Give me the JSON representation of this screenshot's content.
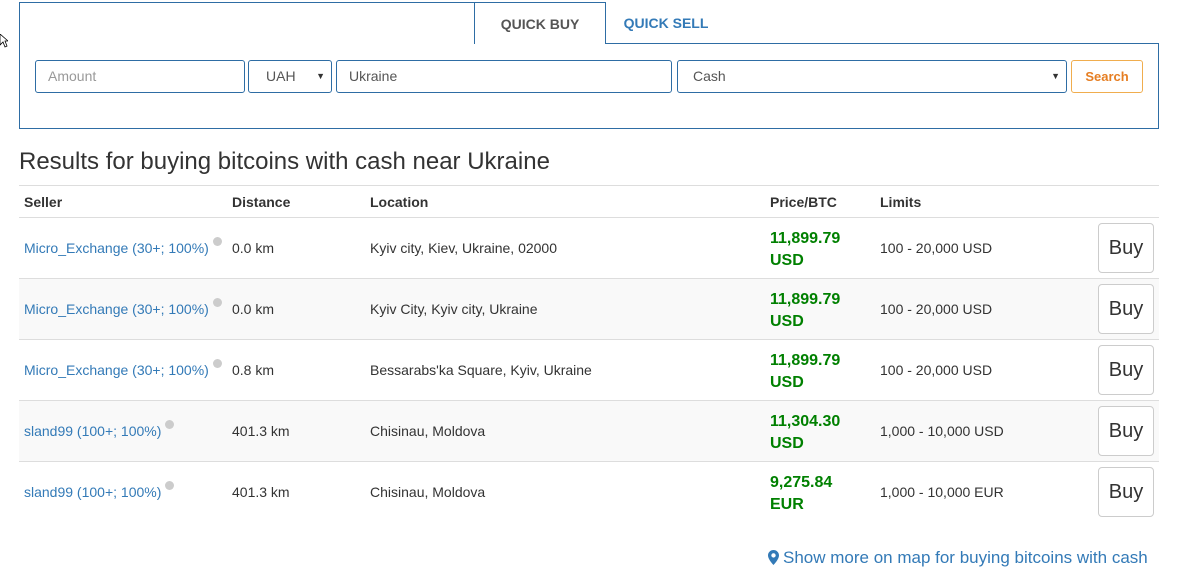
{
  "tabs": {
    "quick_buy": "QUICK BUY",
    "quick_sell": "QUICK SELL"
  },
  "search": {
    "amount_placeholder": "Amount",
    "currency": "UAH",
    "location": "Ukraine",
    "payment_method": "Cash",
    "button_label": "Search"
  },
  "results_title": "Results for buying bitcoins with cash near Ukraine",
  "table": {
    "headers": {
      "seller": "Seller",
      "distance": "Distance",
      "location": "Location",
      "price": "Price/BTC",
      "limits": "Limits"
    },
    "rows": [
      {
        "seller": "Micro_Exchange (30+; 100%)",
        "distance": "0.0 km",
        "location": "Kyiv city, Kiev, Ukraine, 02000",
        "price": "11,899.79",
        "currency": "USD",
        "limits": "100 - 20,000 USD",
        "buy": "Buy"
      },
      {
        "seller": "Micro_Exchange (30+; 100%)",
        "distance": "0.0 km",
        "location": "Kyiv City, Kyiv city, Ukraine",
        "price": "11,899.79",
        "currency": "USD",
        "limits": "100 - 20,000 USD",
        "buy": "Buy"
      },
      {
        "seller": "Micro_Exchange (30+; 100%)",
        "distance": "0.8 km",
        "location": "Bessarabs'ka Square, Kyiv, Ukraine",
        "price": "11,899.79",
        "currency": "USD",
        "limits": "100 - 20,000 USD",
        "buy": "Buy"
      },
      {
        "seller": "sland99 (100+; 100%)",
        "distance": "401.3 km",
        "location": "Chisinau, Moldova",
        "price": "11,304.30",
        "currency": "USD",
        "limits": "1,000 - 10,000 USD",
        "buy": "Buy"
      },
      {
        "seller": "sland99 (100+; 100%)",
        "distance": "401.3 km",
        "location": "Chisinau, Moldova",
        "price": "9,275.84",
        "currency": "EUR",
        "limits": "1,000 - 10,000 EUR",
        "buy": "Buy"
      }
    ]
  },
  "map_link": "Show more on map for buying bitcoins with cash",
  "colors": {
    "accent": "#337ab7",
    "price": "#008000",
    "search": "#e67e22"
  }
}
